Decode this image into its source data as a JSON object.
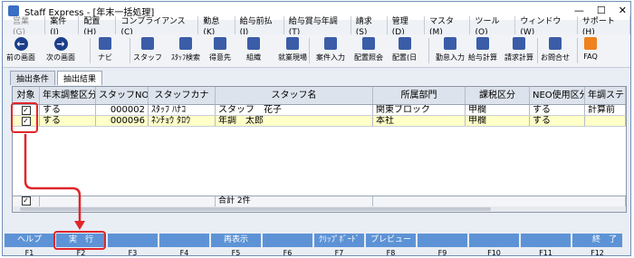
{
  "window": {
    "title": "Staff Express - [年末一括処理]",
    "minimize": "—",
    "maximize": "☐",
    "close": "✕"
  },
  "menu": [
    {
      "label": "営業(G)",
      "dim": true
    },
    {
      "label": "案件(J)"
    },
    {
      "label": "配置(H)"
    },
    {
      "label": "コンプライアンス(C)"
    },
    {
      "label": "勤怠(K)"
    },
    {
      "label": "給与前払(I)"
    },
    {
      "label": "給与賞与年調(T)"
    },
    {
      "label": "請求(S)"
    },
    {
      "label": "管理(D)"
    },
    {
      "label": "マスタ(M)"
    },
    {
      "label": "ツール(O)"
    },
    {
      "label": "ウィンドウ(W)"
    },
    {
      "label": "サポート(H)"
    }
  ],
  "toolbar": [
    {
      "label": "前の画面",
      "icon": "back-arrow-icon",
      "glyph": "←"
    },
    {
      "label": "次の画面",
      "icon": "forward-arrow-icon",
      "glyph": "→"
    },
    {
      "label": "ナビ",
      "icon": "navi-icon"
    },
    {
      "label": "スタッフ",
      "icon": "staff-icon"
    },
    {
      "label": "ｽﾀｯﾌ検索",
      "icon": "staff-search-icon"
    },
    {
      "label": "得意先",
      "icon": "customer-icon"
    },
    {
      "label": "組織",
      "icon": "organization-icon"
    },
    {
      "label": "就業現場",
      "icon": "worksite-icon"
    },
    {
      "label": "案件入力",
      "icon": "case-entry-icon"
    },
    {
      "label": "配置照会",
      "icon": "assignment-inquiry-icon"
    },
    {
      "label": "配置(日",
      "icon": "assignment-day-icon"
    },
    {
      "label": "勤怠入力",
      "icon": "attendance-entry-icon"
    },
    {
      "label": "給与計算",
      "icon": "payroll-icon"
    },
    {
      "label": "請求計算",
      "icon": "billing-icon"
    },
    {
      "label": "お問合せ",
      "icon": "inquiry-icon"
    },
    {
      "label": "FAQ",
      "icon": "faq-icon"
    }
  ],
  "tabs": [
    "抽出条件",
    "抽出結果"
  ],
  "grid": {
    "headers": [
      "対象",
      "年末調整区分",
      "スタッフNO",
      "スタッフカナ",
      "スタッフ名",
      "所属部門",
      "課税区分",
      "NEO使用区分",
      "年調ステ"
    ],
    "rows": [
      {
        "checked": "✓",
        "adjust": "する",
        "no": "000002",
        "kana": "ｽﾀｯﾌ ﾊﾅｺ",
        "name": "スタッフ　花子",
        "dept": "関東ブロック",
        "tax": "甲欄",
        "neo": "する",
        "status": "計算前"
      },
      {
        "checked": "✓",
        "adjust": "する",
        "no": "000096",
        "kana": "ﾈﾝﾁｮｳ ﾀﾛｳ",
        "name": "年調　太郎",
        "dept": "本社",
        "tax": "甲欄",
        "neo": "する",
        "status": ""
      }
    ],
    "footer": {
      "checked": "✓",
      "total": "合計 2件"
    }
  },
  "fkeys": [
    {
      "label": "ヘルプ",
      "key": "F1"
    },
    {
      "label": "実　行",
      "key": "F2"
    },
    {
      "label": "",
      "key": "F3"
    },
    {
      "label": "",
      "key": "F4"
    },
    {
      "label": "再表示",
      "key": "F5"
    },
    {
      "label": "",
      "key": "F6"
    },
    {
      "label": "ｸﾘｯﾌﾟﾎﾞｰﾄﾞ",
      "key": "F7"
    },
    {
      "label": "プレビュー",
      "key": "F8"
    },
    {
      "label": "",
      "key": "F9"
    },
    {
      "label": "",
      "key": "F10"
    },
    {
      "label": "",
      "key": "F11"
    },
    {
      "label": "終　了",
      "key": "F12"
    }
  ],
  "colors": {
    "highlight": "#e0262b",
    "fkey": "#5d93d6",
    "selected_row": "#ffffc8"
  }
}
